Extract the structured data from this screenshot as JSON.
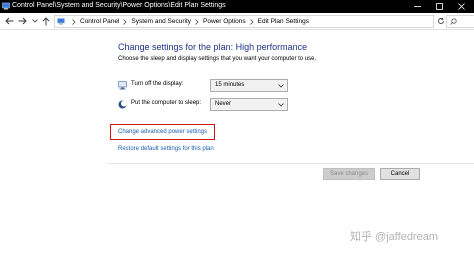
{
  "window": {
    "title": "Control Panel\\System and Security\\Power Options\\Edit Plan Settings"
  },
  "address_bar": {
    "breadcrumbs": [
      "Control Panel",
      "System and Security",
      "Power Options",
      "Edit Plan Settings"
    ]
  },
  "main": {
    "heading": "Change settings for the plan: High performance",
    "subtitle": "Choose the sleep and display settings that you want your computer to use.",
    "display_off": {
      "label": "Turn off the display:",
      "value": "15 minutes"
    },
    "sleep": {
      "label": "Put the computer to sleep:",
      "value": "Never"
    },
    "advanced_link": "Change advanced power settings",
    "restore_link": "Restore default settings for this plan"
  },
  "footer": {
    "save_label": "Save changes",
    "cancel_label": "Cancel"
  },
  "watermark": "知乎 @jaffedream",
  "colors": {
    "heading": "#1e3287",
    "link": "#1a5fb4",
    "highlight": "#d21414",
    "titlebar": "#000000"
  }
}
